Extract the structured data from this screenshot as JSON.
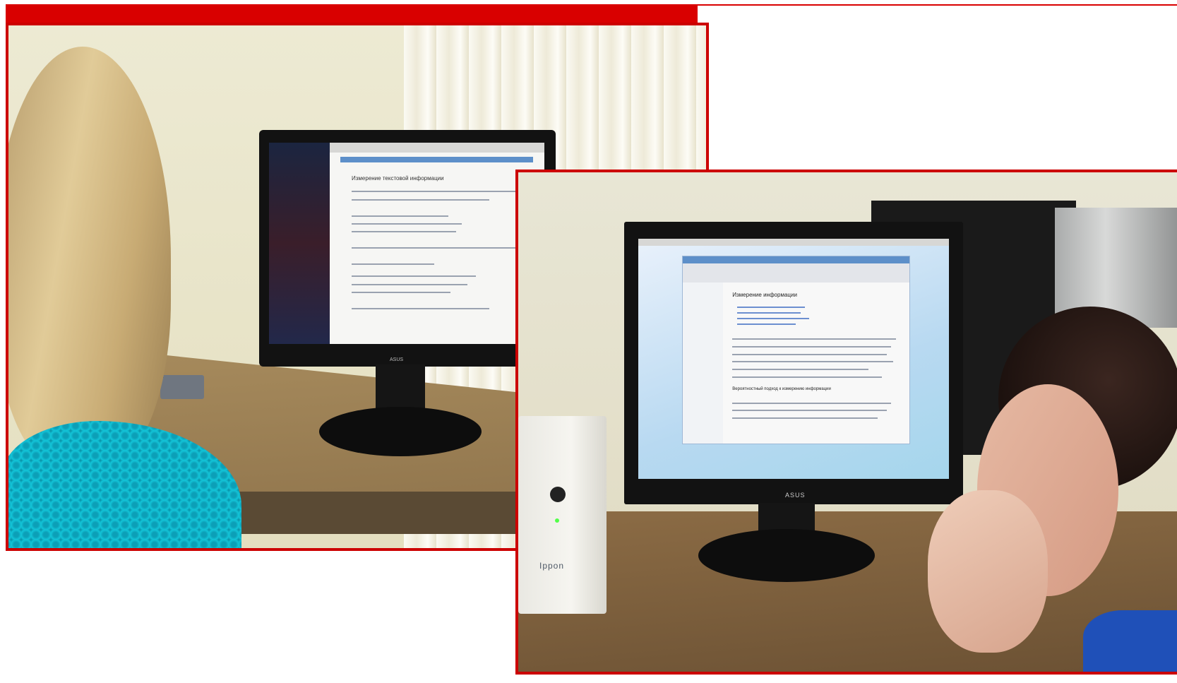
{
  "photo1": {
    "monitor": {
      "page_heading": "Измерение текстовой информации",
      "brand": "ASUS"
    }
  },
  "photo2": {
    "monitor": {
      "page_heading": "Измерение информации",
      "section_heading": "Вероятностный подход к измерению информации",
      "brand": "ASUS"
    },
    "ups": {
      "brand": "Ippon"
    }
  },
  "colors": {
    "frame_accent": "#cc0000"
  }
}
